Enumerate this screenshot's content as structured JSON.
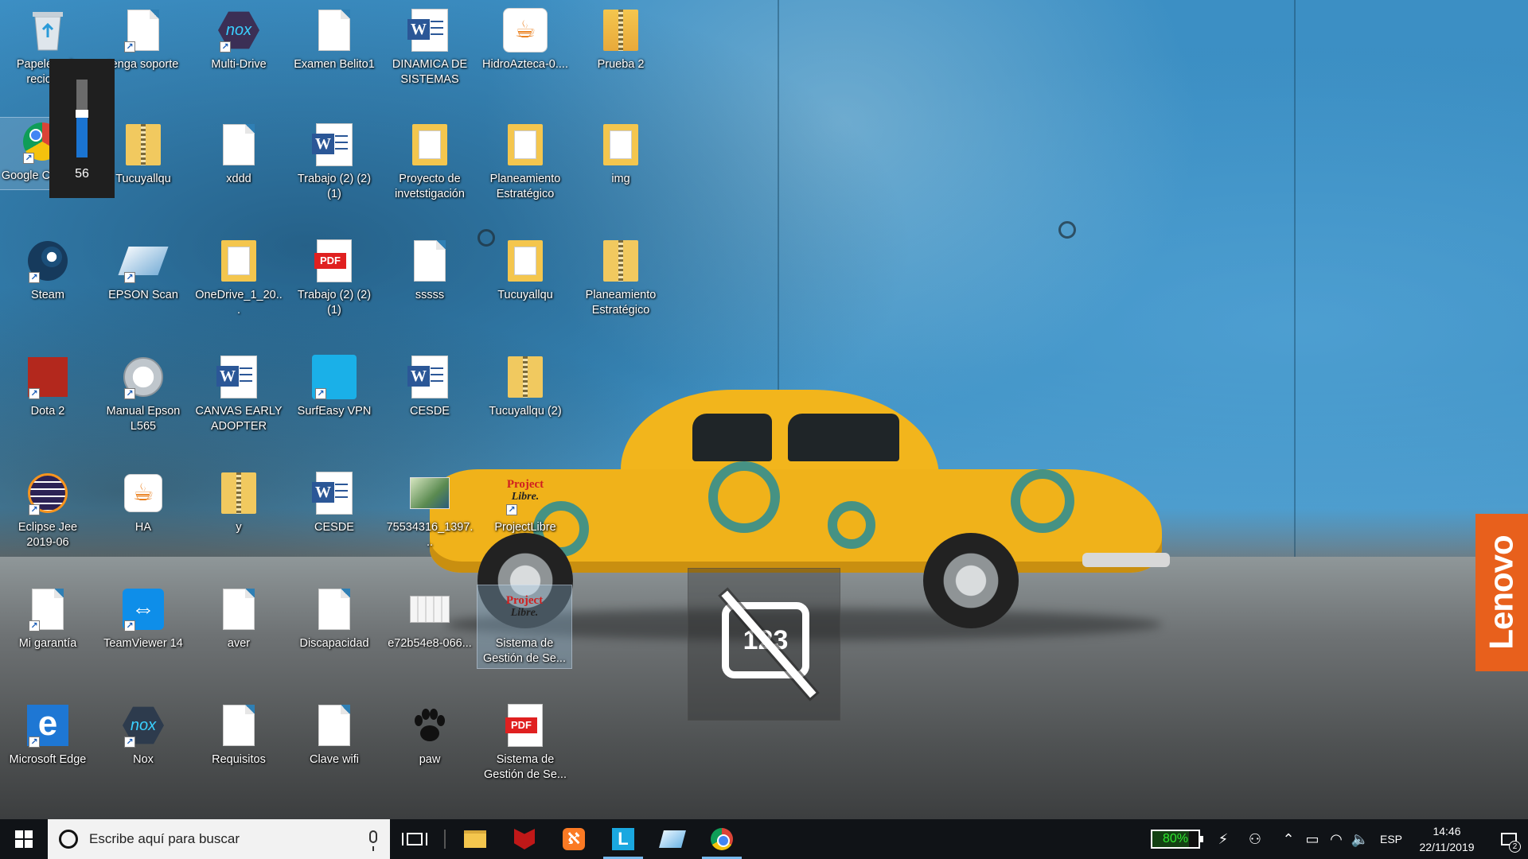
{
  "desktop": {
    "icons": [
      {
        "label": "Papelera de reciclaje",
        "kind": "recycle-bin-icon"
      },
      {
        "label": "tenga soporte",
        "kind": "document-icon"
      },
      {
        "label": "Multi-Drive",
        "kind": "nox-icon"
      },
      {
        "label": "Examen Belito1",
        "kind": "document-icon"
      },
      {
        "label": "DINAMICA DE SISTEMAS",
        "kind": "word-icon"
      },
      {
        "label": "HidroAzteca-0....",
        "kind": "java-icon"
      },
      {
        "label": "Prueba 2",
        "kind": "chrome-zip-icon"
      },
      {
        "label": "Google Chrome",
        "kind": "chrome-icon"
      },
      {
        "label": "Tucuyallqu",
        "kind": "zip-icon"
      },
      {
        "label": "xddd",
        "kind": "document-icon"
      },
      {
        "label": "Trabajo (2) (2) (1)",
        "kind": "word-icon"
      },
      {
        "label": "Proyecto de invetstigación",
        "kind": "folder-icon"
      },
      {
        "label": "Planeamiento Estratégico",
        "kind": "folder-icon"
      },
      {
        "label": "img",
        "kind": "folder-icon"
      },
      {
        "label": "Steam",
        "kind": "steam-icon"
      },
      {
        "label": "EPSON Scan",
        "kind": "scanner-icon"
      },
      {
        "label": "OneDrive_1_20...",
        "kind": "folder-icon"
      },
      {
        "label": "Trabajo (2) (2) (1)",
        "kind": "pdf-icon"
      },
      {
        "label": "sssss",
        "kind": "document-icon"
      },
      {
        "label": "Tucuyallqu",
        "kind": "folder-icon"
      },
      {
        "label": "Planeamiento Estratégico",
        "kind": "zip-icon"
      },
      {
        "label": "Dota 2",
        "kind": "dota-icon"
      },
      {
        "label": "Manual Epson L565",
        "kind": "manual-icon"
      },
      {
        "label": "CANVAS EARLY ADOPTER",
        "kind": "word-icon"
      },
      {
        "label": "SurfEasy VPN",
        "kind": "vpn-icon"
      },
      {
        "label": "CESDE",
        "kind": "word-icon"
      },
      {
        "label": "Tucuyallqu (2)",
        "kind": "zip-icon"
      },
      {
        "label": "Eclipse Jee 2019-06",
        "kind": "eclipse-icon"
      },
      {
        "label": "HA",
        "kind": "java-icon"
      },
      {
        "label": "y",
        "kind": "zip-icon"
      },
      {
        "label": "CESDE",
        "kind": "word-icon"
      },
      {
        "label": "75534316_1397...",
        "kind": "image-icon"
      },
      {
        "label": "ProjectLibre",
        "kind": "projectlibre-icon"
      },
      {
        "label": "Mi garantía",
        "kind": "document-icon"
      },
      {
        "label": "TeamViewer 14",
        "kind": "teamviewer-icon"
      },
      {
        "label": "aver",
        "kind": "document-icon"
      },
      {
        "label": "Discapacidad",
        "kind": "document-icon"
      },
      {
        "label": "e72b54e8-066...",
        "kind": "image-icon"
      },
      {
        "label": "Sistema de Gestión de Se...",
        "kind": "projectlibre-icon"
      },
      {
        "label": "Microsoft Edge",
        "kind": "edge-icon"
      },
      {
        "label": "Nox",
        "kind": "nox-icon"
      },
      {
        "label": "Requisitos",
        "kind": "document-icon"
      },
      {
        "label": "Clave wifi",
        "kind": "document-icon"
      },
      {
        "label": "paw",
        "kind": "paw-icon"
      },
      {
        "label": "Sistema de Gestión de Se...",
        "kind": "pdf-icon"
      }
    ]
  },
  "volume_flyout": {
    "value": "56",
    "level": 0.56
  },
  "osd": {
    "label": "123",
    "icon": "num-lock-off-icon"
  },
  "wallpaper": {
    "brand": "Lenovo",
    "brand_color": "#e8601c"
  },
  "taskbar": {
    "search_placeholder": "Escribe aquí para buscar",
    "apps": [
      "task-view-icon",
      "file-explorer-icon",
      "mcafee-icon",
      "xampp-icon",
      "l-app-icon",
      "epson-icon",
      "chrome-icon"
    ],
    "battery_label": "80%",
    "battery_level": 0.8,
    "language": "ESP",
    "time": "14:46",
    "date": "22/11/2019",
    "notification_count": "2"
  }
}
